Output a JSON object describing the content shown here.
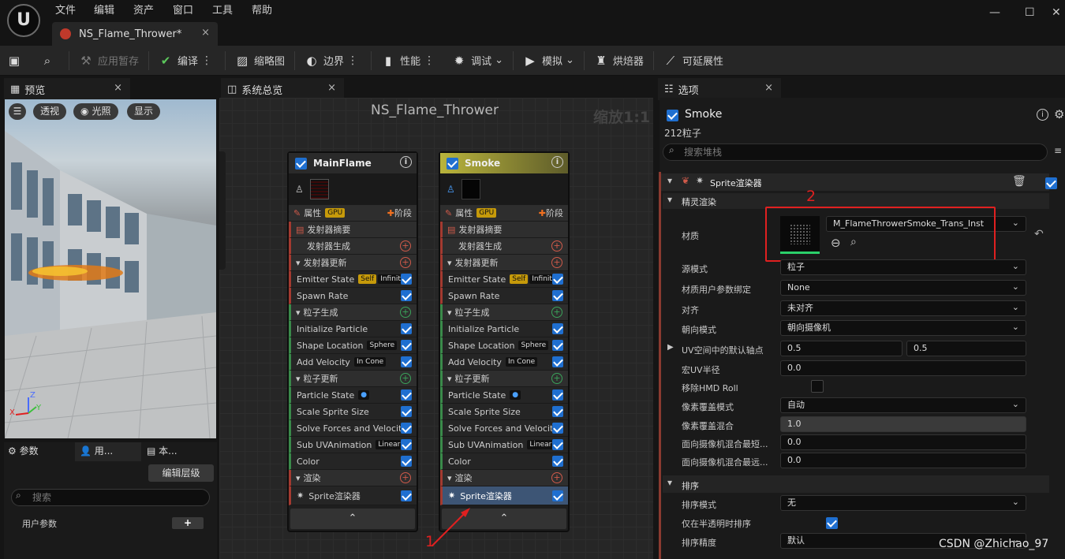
{
  "titlebar": {
    "menu": [
      "文件",
      "编辑",
      "资产",
      "窗口",
      "工具",
      "帮助"
    ],
    "doc_tab": "NS_Flame_Thrower*",
    "close": "×",
    "window_controls": [
      "—",
      "☐",
      "✕"
    ]
  },
  "toolbar": {
    "apply_pending": "应用暂存",
    "compile": "编译",
    "thumbnail": "缩略图",
    "bounds": "边界",
    "performance": "性能",
    "debug": "调试",
    "simulate": "模拟",
    "baker": "烘焙器",
    "scalability": "可延展性"
  },
  "preview": {
    "tab": "预览",
    "perspective": "透视",
    "lighting": "光照",
    "show": "显示",
    "axis_x": "X",
    "axis_y": "Y",
    "axis_z": "Z"
  },
  "params": {
    "tab_params": "参数",
    "tab_user": "用...",
    "tab_local": "本...",
    "edit_hierarchy": "编辑层级",
    "search_placeholder": "搜索",
    "user_params": "用户参数"
  },
  "graph": {
    "tab": "系统总览",
    "title": "NS_Flame_Thrower",
    "zoom": "缩放1:1",
    "annotation1": "1",
    "nodes": [
      {
        "name": "MainFlame",
        "properties": "属性",
        "gpu": "GPU",
        "stage": "阶段",
        "emitter_summary": "发射器摘要",
        "emitter_spawn": "发射器生成",
        "emitter_update": "发射器更新",
        "emitter_state": "Emitter State",
        "self": "Self",
        "infinite": "Infinite",
        "spawn_rate": "Spawn Rate",
        "particle_spawn": "粒子生成",
        "init_particle": "Initialize Particle",
        "shape_location": "Shape Location",
        "sphere": "Sphere",
        "add_velocity": "Add Velocity",
        "in_cone": "In Cone",
        "particle_update": "粒子更新",
        "particle_state": "Particle State",
        "scale_sprite": "Scale Sprite Size",
        "solve_forces": "Solve Forces and Velocity",
        "sub_uv": "Sub UVAnimation",
        "linear": "Linear",
        "color": "Color",
        "render": "渲染",
        "sprite_renderer": "Sprite渲染器"
      },
      {
        "name": "Smoke",
        "properties": "属性",
        "gpu": "GPU",
        "stage": "阶段",
        "emitter_summary": "发射器摘要",
        "emitter_spawn": "发射器生成",
        "emitter_update": "发射器更新",
        "emitter_state": "Emitter State",
        "self": "Self",
        "infinite": "Infinite",
        "spawn_rate": "Spawn Rate",
        "particle_spawn": "粒子生成",
        "init_particle": "Initialize Particle",
        "shape_location": "Shape Location",
        "sphere": "Sphere",
        "add_velocity": "Add Velocity",
        "in_cone": "In Cone",
        "particle_update": "粒子更新",
        "particle_state": "Particle State",
        "scale_sprite": "Scale Sprite Size",
        "solve_forces": "Solve Forces and Velocity",
        "sub_uv": "Sub UVAnimation",
        "linear": "Linear",
        "color": "Color",
        "render": "渲染",
        "sprite_renderer": "Sprite渲染器"
      }
    ]
  },
  "details": {
    "tab": "选项",
    "emitter_name": "Smoke",
    "particle_count": "212粒子",
    "search_placeholder": "搜索堆栈",
    "sprite_renderer": "Sprite渲染器",
    "sprite_render": "精灵渲染",
    "annotation2": "2",
    "material_label": "材质",
    "material_value": "M_FlameThrowerSmoke_Trans_Inst",
    "source_mode_label": "源模式",
    "source_mode_value": "粒子",
    "mat_user_param_label": "材质用户参数绑定",
    "mat_user_param_value": "None",
    "alignment_label": "对齐",
    "alignment_value": "未对齐",
    "facing_label": "朝向模式",
    "facing_value": "朝向摄像机",
    "uv_pivot_label": "UV空间中的默认轴点",
    "uv_pivot_x": "0.5",
    "uv_pivot_y": "0.5",
    "macro_uv_label": "宏UV半径",
    "macro_uv_value": "0.0",
    "remove_hmd_label": "移除HMD Roll",
    "pixel_cov_mode_label": "像素覆盖模式",
    "pixel_cov_mode_value": "自动",
    "pixel_cov_blend_label": "像素覆盖混合",
    "pixel_cov_blend_value": "1.0",
    "cam_blend_near_label": "面向摄像机混合最短...",
    "cam_blend_near_value": "0.0",
    "cam_blend_far_label": "面向摄像机混合最远...",
    "cam_blend_far_value": "0.0",
    "sorting": "排序",
    "sort_mode_label": "排序模式",
    "sort_mode_value": "无",
    "sort_translucent_label": "仅在半透明时排序",
    "sort_precision_label": "排序精度",
    "sort_precision_value": "默认"
  },
  "watermark": "CSDN @Zhichao_97",
  "colors": {
    "accent": "#1f6fd0",
    "highlight_red": "#e02020",
    "smoke_header": "#b9b43c"
  }
}
